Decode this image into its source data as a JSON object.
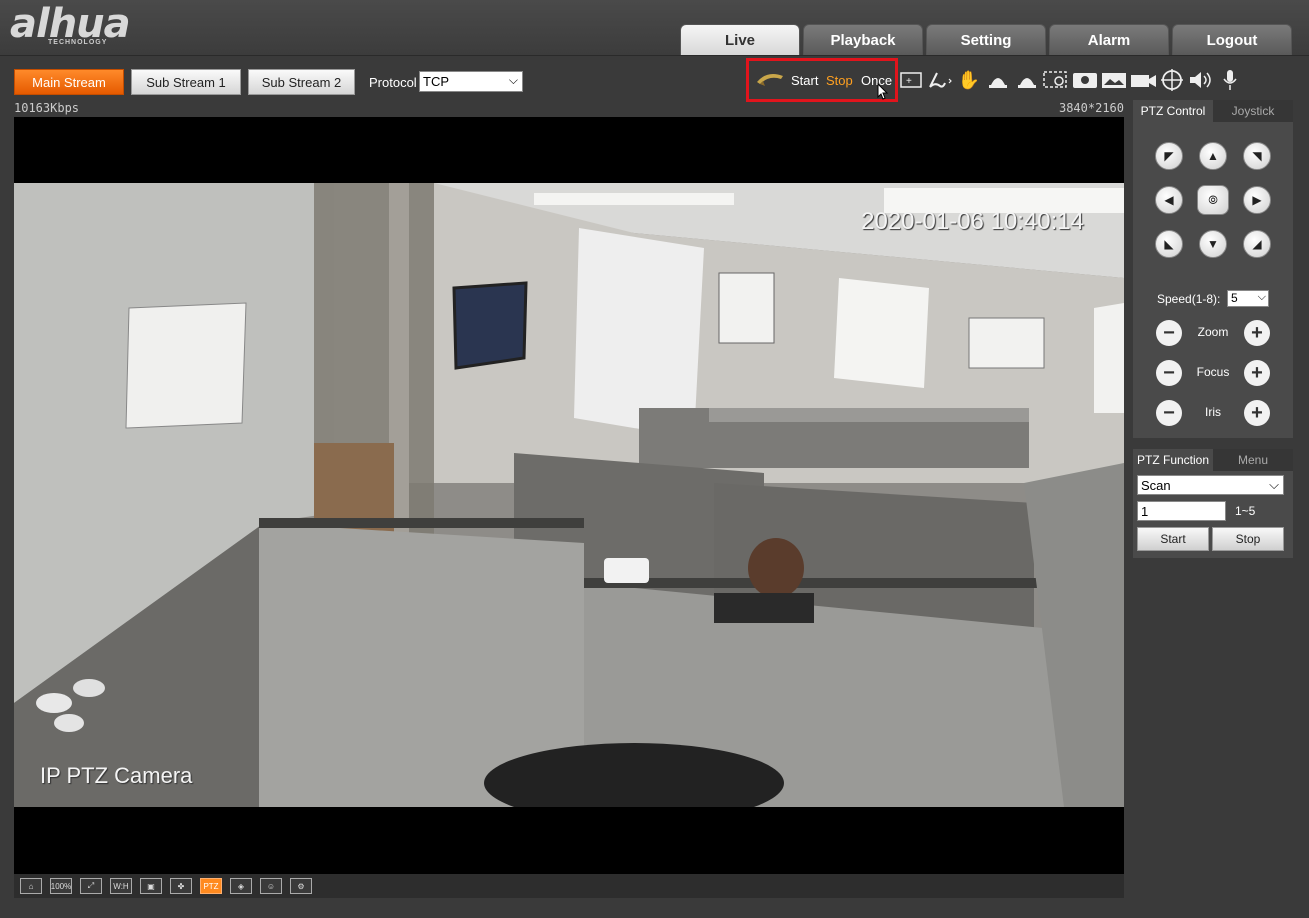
{
  "logo": {
    "name": "alhua",
    "sub": "TECHNOLOGY"
  },
  "main_tabs": [
    {
      "label": "Live",
      "active": true
    },
    {
      "label": "Playback"
    },
    {
      "label": "Setting"
    },
    {
      "label": "Alarm"
    },
    {
      "label": "Logout"
    }
  ],
  "streams": {
    "main": "Main Stream",
    "sub1": "Sub Stream 1",
    "sub2": "Sub Stream 2",
    "active": "Main Stream"
  },
  "protocol": {
    "label": "Protocol",
    "value": "TCP"
  },
  "recording": {
    "start": "Start",
    "stop": "Stop",
    "once": "Once"
  },
  "video": {
    "bitrate": "10163Kbps",
    "resolution": "3840*2160",
    "timestamp": "2020-01-06 10:40:14",
    "camera_label": "IP PTZ Camera"
  },
  "bottom_bar": {
    "zoom": "100%",
    "wh": "W:H",
    "ptz": "PTZ"
  },
  "ptz_control": {
    "tab_active": "PTZ Control",
    "tab_other": "Joystick",
    "speed_label": "Speed(1-8):",
    "speed_value": "5",
    "zoom": "Zoom",
    "focus": "Focus",
    "iris": "Iris"
  },
  "ptz_function": {
    "tab_active": "PTZ Function",
    "tab_other": "Menu",
    "mode": "Scan",
    "number": "1",
    "range": "1~5",
    "start": "Start",
    "stop": "Stop"
  },
  "colors": {
    "accent": "#ff7a00",
    "highlight_box": "#e1141c",
    "stop_text": "#ffa020"
  }
}
